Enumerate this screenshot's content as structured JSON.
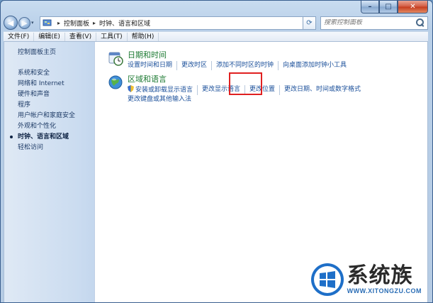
{
  "window": {
    "controls": {
      "minimize": "–",
      "maximize": "□",
      "close": "✕"
    }
  },
  "address_bar": {
    "breadcrumbs": [
      "控制面板",
      "时钟、语言和区域"
    ],
    "search_placeholder": "搜索控制面板"
  },
  "menu": [
    "文件(F)",
    "编辑(E)",
    "查看(V)",
    "工具(T)",
    "帮助(H)"
  ],
  "sidebar": {
    "home": "控制面板主页",
    "items": [
      {
        "label": "系统和安全",
        "active": false
      },
      {
        "label": "网络和 Internet",
        "active": false
      },
      {
        "label": "硬件和声音",
        "active": false
      },
      {
        "label": "程序",
        "active": false
      },
      {
        "label": "用户帐户和家庭安全",
        "active": false
      },
      {
        "label": "外观和个性化",
        "active": false
      },
      {
        "label": "时钟、语言和区域",
        "active": true
      },
      {
        "label": "轻松访问",
        "active": false
      }
    ]
  },
  "categories": [
    {
      "title": "日期和时间",
      "icon": "clock-icon",
      "links": [
        "设置时间和日期",
        "更改时区",
        "添加不同时区的时钟",
        "向桌面添加时钟小工具"
      ]
    },
    {
      "title": "区域和语言",
      "icon": "globe-icon",
      "links": [
        "安装或卸载显示语言",
        "更改显示语言",
        "更改位置",
        "更改日期、时间或数字格式",
        "更改键盘或其他输入法"
      ]
    }
  ],
  "watermark": {
    "main": "系统族",
    "url": "WWW.XITONGZU.COM"
  },
  "colors": {
    "highlight": "#e02020",
    "link": "#1a4f9a",
    "category_title": "#1c7a32"
  }
}
